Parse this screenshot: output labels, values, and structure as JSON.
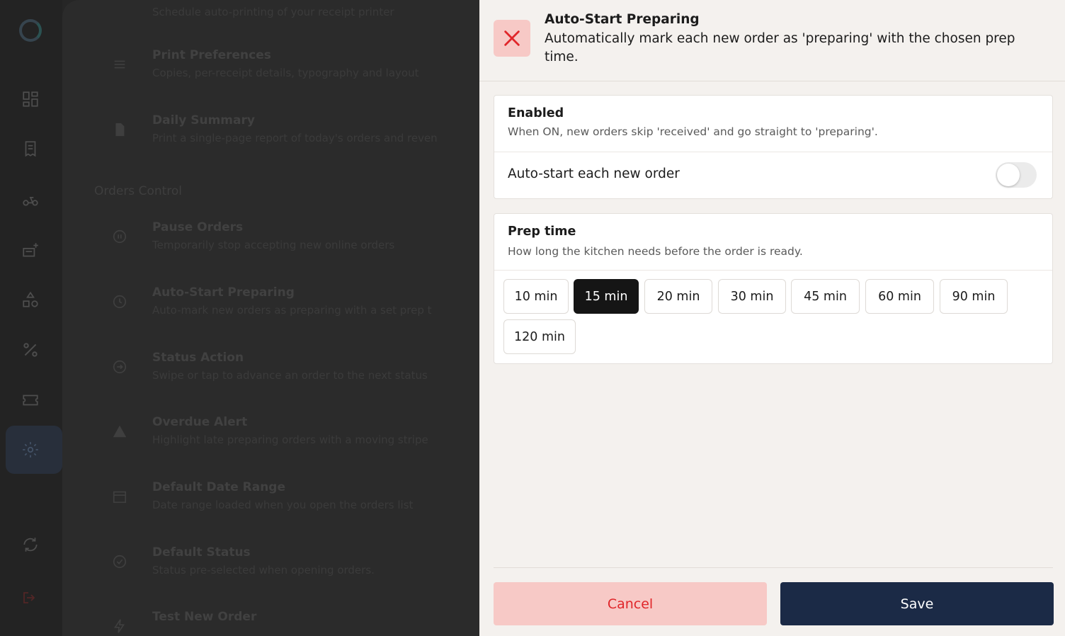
{
  "background": {
    "rows_top": [
      {
        "title": "",
        "subtitle": "Schedule auto-printing of your receipt printer"
      },
      {
        "title": "Print Preferences",
        "subtitle": "Copies, per-receipt details, typography and layout"
      },
      {
        "title": "Daily Summary",
        "subtitle": "Print a single-page report of today's orders and reven"
      }
    ],
    "section_title": "Orders Control",
    "rows": [
      {
        "title": "Pause Orders",
        "subtitle": "Temporarily stop accepting new online orders"
      },
      {
        "title": "Auto-Start Preparing",
        "subtitle": "Auto-mark new orders as preparing with a set prep t"
      },
      {
        "title": "Status Action",
        "subtitle": "Swipe or tap to advance an order to the next status"
      },
      {
        "title": "Overdue Alert",
        "subtitle": "Highlight late preparing orders with a moving stripe"
      },
      {
        "title": "Default Date Range",
        "subtitle": "Date range loaded when you open the orders list"
      },
      {
        "title": "Default Status",
        "subtitle": "Status pre-selected when opening orders."
      },
      {
        "title": "Test New Order",
        "subtitle": ""
      }
    ]
  },
  "drawer": {
    "title": "Auto-Start Preparing",
    "subtitle": "Automatically mark each new order as 'preparing' with the chosen prep time.",
    "enabled_card": {
      "title": "Enabled",
      "description": "When ON, new orders skip 'received' and go straight to 'preparing'.",
      "toggle_label": "Auto-start each new order",
      "toggle_on": false
    },
    "prep_card": {
      "title": "Prep time",
      "description": "How long the kitchen needs before the order is ready.",
      "options": [
        "10 min",
        "15 min",
        "20 min",
        "30 min",
        "45 min",
        "60 min",
        "90 min",
        "120 min"
      ],
      "selected": "15 min"
    },
    "cancel_label": "Cancel",
    "save_label": "Save"
  },
  "colors": {
    "accent_danger": "#e0262a",
    "danger_bg": "#f7c9c6",
    "primary_dark": "#1b2a46",
    "selected_chip": "#151515"
  },
  "icons": {
    "close": "close-icon",
    "sidebar": [
      "dashboard-icon",
      "orders-icon",
      "delivery-icon",
      "menu-icon",
      "categories-icon",
      "discount-icon",
      "coupon-icon",
      "settings-icon",
      "sync-icon",
      "logout-icon"
    ]
  }
}
